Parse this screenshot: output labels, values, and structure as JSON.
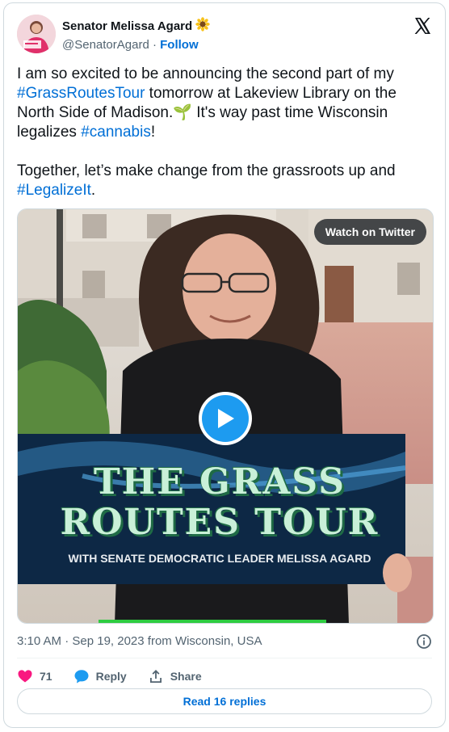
{
  "author": {
    "display_name": "Senator Melissa Agard",
    "name_emoji": "sunflower",
    "handle": "@SenatorAgard",
    "separator": "·",
    "follow_label": "Follow"
  },
  "tweet": {
    "p1": {
      "t1": "I am so excited to be announcing the second part of my ",
      "tag1": "#GrassRoutesTour",
      "t2": " tomorrow at Lakeview Library on the North Side of Madison.",
      "emoji": "🌱",
      "t3": " It's way past time Wisconsin legalizes ",
      "tag2": "#cannabis",
      "t4": "!"
    },
    "p2": {
      "t1": "Together, let’s make change from the grassroots up and ",
      "tag1": "#LegalizeIt",
      "t2": "."
    }
  },
  "media": {
    "watch_label": "Watch on Twitter",
    "sign_line1": "THE GRASS",
    "sign_line2": "ROUTES TOUR",
    "sign_subtitle": "WITH SENATE DEMOCRATIC LEADER MELISSA AGARD",
    "progress": 0.55
  },
  "meta": {
    "timestamp": "3:10 AM · Sep 19, 2023 from Wisconsin, USA"
  },
  "actions": {
    "like_count": "71",
    "reply_label": "Reply",
    "share_label": "Share"
  },
  "read_replies_label": "Read 16 replies",
  "colors": {
    "link": "#006fd6",
    "like": "#f91880",
    "reply": "#1d9bf0",
    "play": "#1d9bf0"
  }
}
